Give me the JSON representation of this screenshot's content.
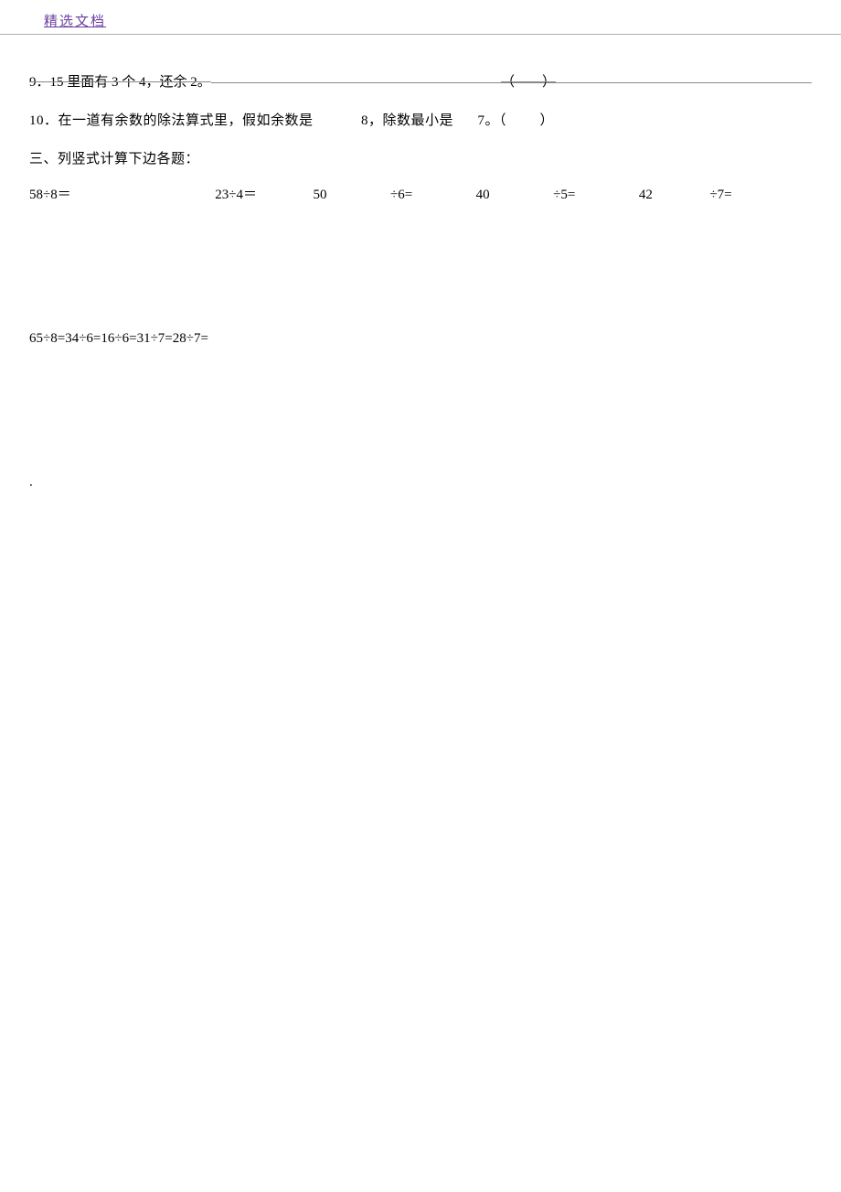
{
  "header": {
    "title": "精选文档"
  },
  "q9": {
    "text": "9．15 里面有 3 个 4，还余 2。",
    "paren": "（　　）"
  },
  "q10": {
    "prefix": "10．在一道有余数的除法算式里，假如余数是",
    "val1": "8，除数最小是",
    "val2": "7。（",
    "close": "）"
  },
  "section3": {
    "title": "三、列竖式计算下边各题："
  },
  "row1": {
    "e1": "58÷8＝",
    "e2": "23÷4＝",
    "e3a": "50",
    "e3b": "÷6=",
    "e4a": "40",
    "e4b": "÷5=",
    "e5a": "42",
    "e5b": "÷7="
  },
  "row2": {
    "text": "65÷8=34÷6=16÷6=31÷7=28÷7="
  },
  "dot": "."
}
